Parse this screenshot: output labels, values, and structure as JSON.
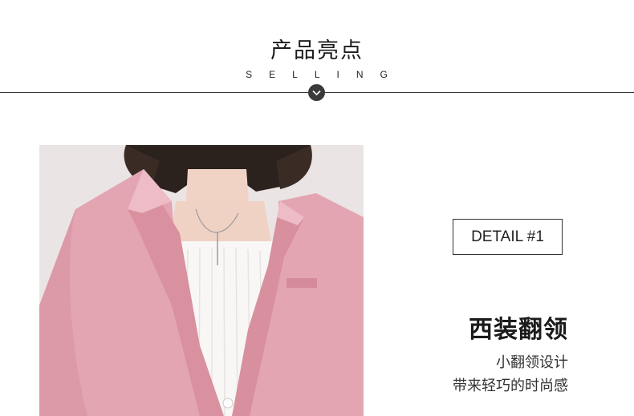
{
  "header": {
    "title": "产品亮点",
    "subtitle": "SELLING",
    "divider_icon": "chevron-down-icon"
  },
  "detail": {
    "label": "DETAIL #1",
    "title": "西装翻领",
    "lines": [
      "小翻领设计",
      "带来轻巧的时尚感"
    ]
  },
  "photo": {
    "subject": "pink-blazer-model-photo"
  },
  "colors": {
    "blazer": "#e4a7b3",
    "divider": "#333333",
    "knob": "#3a3a3a"
  }
}
